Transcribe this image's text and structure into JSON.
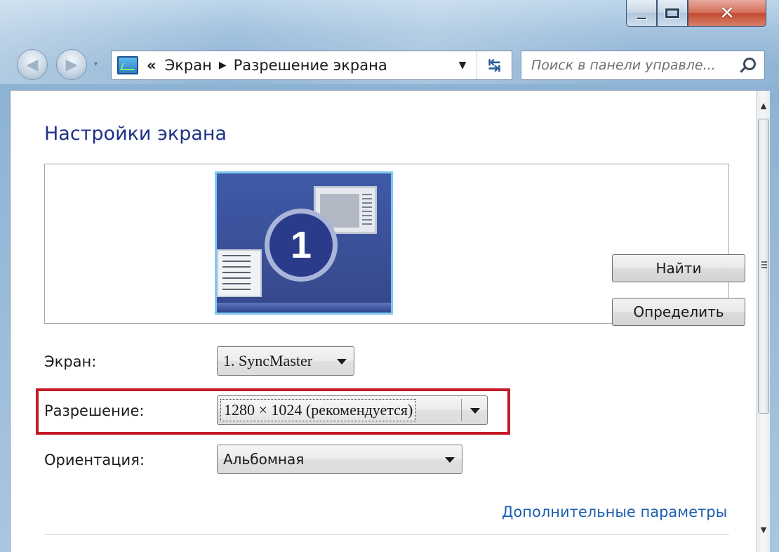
{
  "caption": {
    "minimize_glyph": "▬",
    "maximize_glyph": "▢",
    "close_glyph": "✕"
  },
  "nav": {
    "back_glyph": "◀",
    "forward_glyph": "▶",
    "recent_glyph": "▾"
  },
  "address": {
    "overflow": "«",
    "crumbs": [
      "Экран",
      "Разрешение экрана"
    ],
    "separator": "▶",
    "dropdown_glyph": "▼",
    "refresh_glyph": "↹"
  },
  "search": {
    "placeholder": "Поиск в панели управле..."
  },
  "page": {
    "title": "Настройки экрана"
  },
  "preview": {
    "monitor_number": "1"
  },
  "buttons": {
    "find": "Найти",
    "identify": "Определить"
  },
  "settings": {
    "screen_label": "Экран:",
    "screen_value": "1. SyncMaster",
    "resolution_label": "Разрешение:",
    "resolution_value": "1280 × 1024 (рекомендуется)",
    "orientation_label": "Ориентация:",
    "orientation_value": "Альбомная"
  },
  "links": {
    "advanced": "Дополнительные параметры"
  },
  "colors": {
    "title_blue": "#1e3287",
    "link_blue": "#1f5fb0",
    "highlight_red": "#c41a27",
    "close_red": "#c44a33"
  }
}
